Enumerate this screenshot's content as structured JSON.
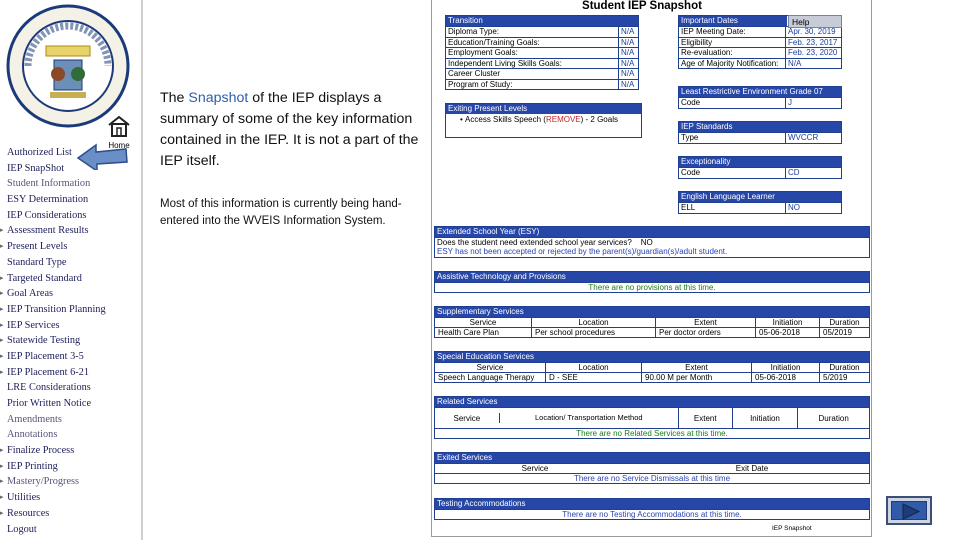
{
  "sidebar": {
    "home_label": "Home",
    "items": [
      "Authorized List",
      "IEP SnapShot",
      "Student Information",
      "ESY Determination",
      "IEP Considerations",
      "Assessment Results",
      "Present Levels",
      "Standard Type",
      "Targeted Standard",
      "Goal Areas",
      "IEP Transition Planning",
      "IEP Services",
      "Statewide Testing",
      "IEP Placement 3-5",
      "IEP Placement 6-21",
      "LRE Considerations",
      "Prior Written Notice",
      "Amendments",
      "Annotations",
      "Finalize Process",
      "IEP Printing",
      "Mastery/Progress",
      "Utilities",
      "Resources",
      "Logout"
    ]
  },
  "explanation": {
    "pre": "The ",
    "highlight": "Snapshot",
    "post": " of the IEP displays a summary of some of the key information contained in the IEP. It is not a part of the IEP itself.",
    "secondary": "Most of this information is currently being hand-entered into the WVEIS Information System."
  },
  "snapshot": {
    "title": "Student IEP Snapshot",
    "help_label": "Help",
    "footer": "IEP Snapshot",
    "transition": {
      "header": "Transition",
      "rows": [
        {
          "k": "Diploma Type:",
          "v": "N/A"
        },
        {
          "k": "Education/Training Goals:",
          "v": "N/A"
        },
        {
          "k": "Employment Goals:",
          "v": "N/A"
        },
        {
          "k": "Independent Living Skills Goals:",
          "v": "N/A"
        },
        {
          "k": "Career Cluster",
          "v": "N/A"
        },
        {
          "k": "Program of Study:",
          "v": "N/A"
        }
      ]
    },
    "important_dates": {
      "header": "Important Dates",
      "rows": [
        {
          "k": "IEP Meeting Date:",
          "v": "Apr. 30, 2019"
        },
        {
          "k": "Eligibility",
          "v": "Feb. 23, 2017"
        },
        {
          "k": "Re-evaluation:",
          "v": "Feb. 23, 2020"
        },
        {
          "k": "Age of Majority Notification:",
          "v": "N/A"
        }
      ]
    },
    "exiting": {
      "header": "Exiting Present Levels",
      "item": "Access Skills Speech (",
      "remove": "REMOVE",
      "item_end": ") - 2 Goals"
    },
    "lre": {
      "header": "Least Restrictive Environment Grade 07",
      "k": "Code",
      "v": "J"
    },
    "standards": {
      "header": "IEP Standards",
      "k": "Type",
      "v": "WVCCR"
    },
    "exceptionality": {
      "header": "Exceptionality",
      "k": "Code",
      "v": "CD"
    },
    "ell": {
      "header": "English Language Learner",
      "k": "ELL",
      "v": "NO"
    },
    "esy": {
      "header": "Extended School Year (ESY)",
      "question": "Does the student need extended school year services?",
      "answer": "NO",
      "note": "ESY has not been accepted or rejected by the parent(s)/guardian(s)/adult student."
    },
    "at": {
      "header": "Assistive Technology and Provisions",
      "note": "There are no provisions at this time."
    },
    "supplementary": {
      "header": "Supplementary Services",
      "columns": [
        "Service",
        "Location",
        "Extent",
        "Initiation",
        "Duration"
      ],
      "row": [
        "Health Care Plan",
        "Per school procedures",
        "Per doctor orders",
        "05-06-2018",
        "05/2019"
      ]
    },
    "special_ed": {
      "header": "Special Education Services",
      "columns": [
        "Service",
        "Location",
        "Extent",
        "Initiation",
        "Duration"
      ],
      "row": [
        "Speech Language Therapy",
        "D - SEE",
        "90.00 M per Month",
        "05-06-2018",
        "5/2019"
      ]
    },
    "related": {
      "header": "Related Services",
      "columns": [
        "Service",
        "Location/ Transportation Method",
        "Extent",
        "Initiation",
        "Duration"
      ],
      "note": "There are no Related Services at this time."
    },
    "exited": {
      "header": "Exited Services",
      "columns": [
        "Service",
        "Exit Date"
      ],
      "note": "There are no Service Dismissals at this time"
    },
    "testing": {
      "header": "Testing Accommodations",
      "note": "There are no Testing Accommodations at this time."
    }
  },
  "colors": {
    "header_blue": "#2747a8",
    "value_blue": "#1a3f9a",
    "note_green": "#1a7a1a",
    "remove_red": "#c0282e",
    "highlight_blue": "#2f5fa8"
  }
}
